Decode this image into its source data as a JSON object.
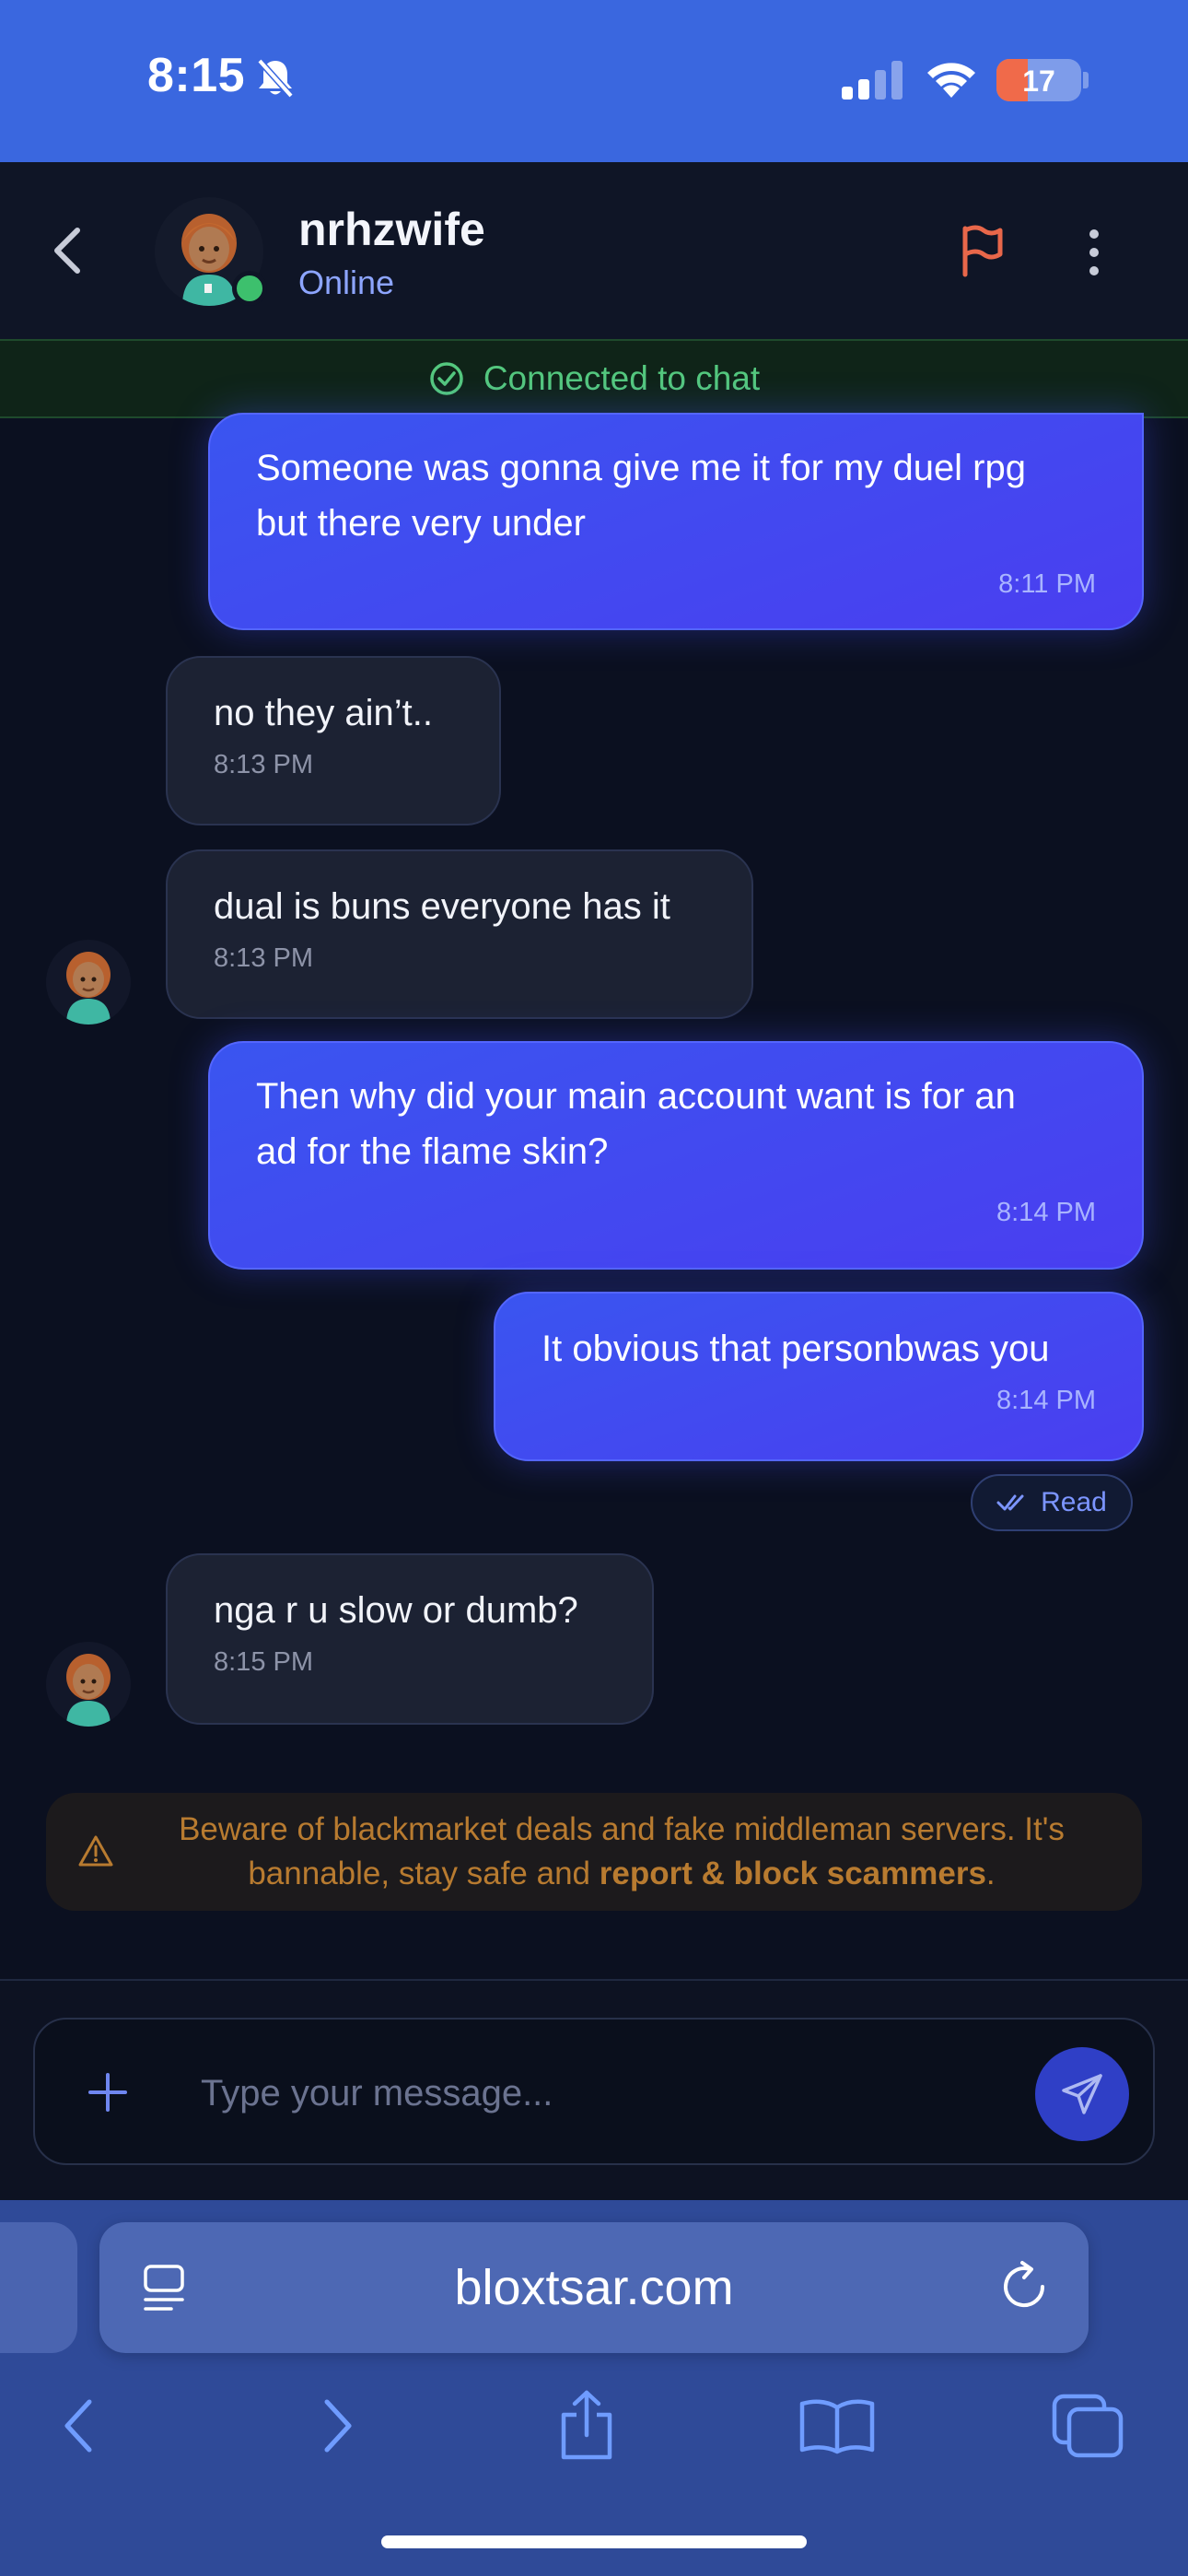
{
  "status_bar": {
    "time": "8:15",
    "battery": "17",
    "icons": [
      "bell-slash-icon",
      "cellular-signal-icon",
      "wifi-icon",
      "battery-icon"
    ]
  },
  "header": {
    "username": "nrhzwife",
    "status": "Online",
    "icons": [
      "chevron-left-icon",
      "flag-icon",
      "more-vertical-icon"
    ]
  },
  "connection": {
    "text": "Connected to chat"
  },
  "messages": [
    {
      "direction": "out",
      "lines": [
        "Someone was gonna give me it for my duel rpg",
        "but there very under"
      ],
      "time": "8:11 PM"
    },
    {
      "direction": "in",
      "text": "no they ain’t..",
      "time": "8:13 PM"
    },
    {
      "direction": "in",
      "text": "dual is buns everyone has it",
      "time": "8:13 PM"
    },
    {
      "direction": "out",
      "lines": [
        "Then why did your main account want is for an",
        "ad for the flame skin?"
      ],
      "time": "8:14 PM"
    },
    {
      "direction": "out",
      "text": "It obvious that personbwas you",
      "time": "8:14 PM"
    },
    {
      "direction": "in",
      "text": "nga r u slow or dumb?",
      "time": "8:15 PM"
    }
  ],
  "read_receipt": "Read",
  "warning": {
    "line1": "Beware of blackmarket deals and fake middleman servers. It's",
    "line2_prefix": "bannable, stay safe and ",
    "line2_bold": "report & block scammers",
    "line2_suffix": "."
  },
  "composer": {
    "placeholder": "Type your message..."
  },
  "browser": {
    "url": "bloxtsar.com"
  },
  "colors": {
    "accent": "#3a55f0",
    "online": "#3dc06d",
    "warning": "#b87b30",
    "flag": "#e8674a"
  }
}
